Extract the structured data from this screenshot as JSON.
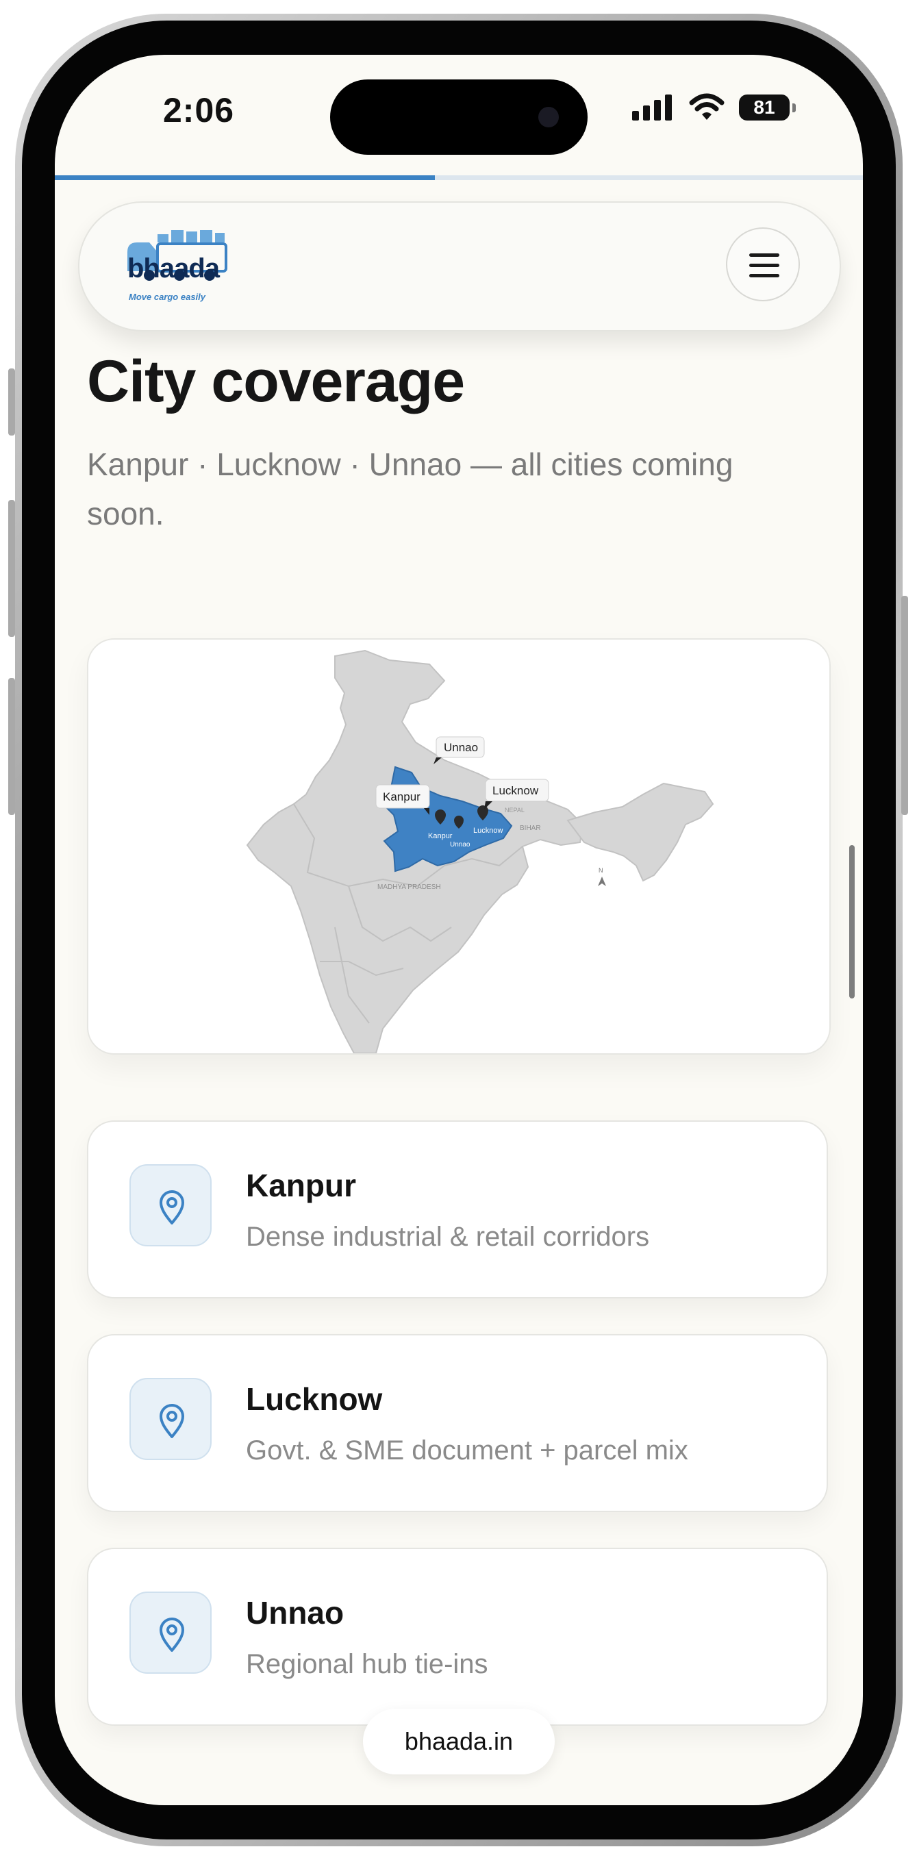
{
  "status_bar": {
    "time": "2:06",
    "battery": "81"
  },
  "header": {
    "logo_word": "bhaada",
    "logo_tagline": "Move cargo easily",
    "menu_icon": "hamburger-menu-icon"
  },
  "page": {
    "progress": 0.47,
    "title": "City coverage",
    "subtitle": "Kanpur · Lucknow · Unnao — all cities coming soon."
  },
  "map": {
    "labels": {
      "unnao": "Unnao",
      "kanpur": "Kanpur",
      "lucknow": "Lucknow",
      "bihar": "BIHAR",
      "madhya_pradesh": "MADHYA PRADESH",
      "nepal": "NEPAL",
      "north": "N"
    },
    "colors": {
      "land": "#d5d5d5",
      "highlight": "#3f82c4",
      "border": "#bdbdbd"
    }
  },
  "cities": [
    {
      "name": "Kanpur",
      "description": "Dense industrial & retail corridors",
      "icon": "map-pin-icon"
    },
    {
      "name": "Lucknow",
      "description": "Govt. & SME document + parcel mix",
      "icon": "map-pin-icon"
    },
    {
      "name": "Unnao",
      "description": "Regional hub tie-ins",
      "icon": "map-pin-icon"
    }
  ],
  "footer": {
    "url": "bhaada.in"
  }
}
